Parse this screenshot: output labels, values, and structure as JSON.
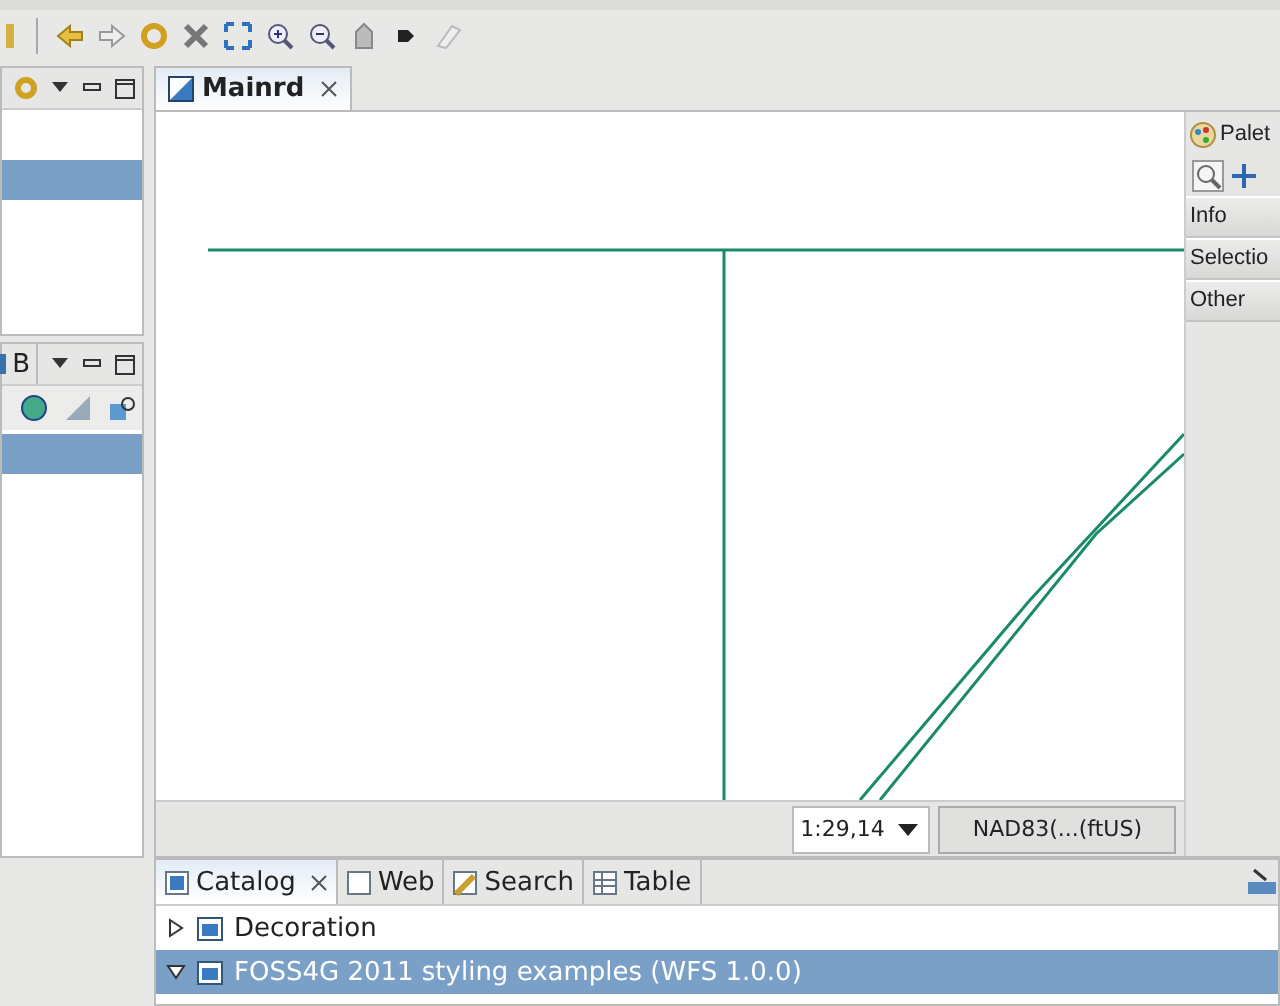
{
  "left_views": [
    {
      "selected_row": true
    },
    {
      "tab": "B",
      "selected_row": true
    }
  ],
  "editor": {
    "tab": {
      "label": "Mainrd",
      "selected": true
    },
    "status_bar": {
      "scale": "1:29,14",
      "crs": "NAD83(...(ftUS)"
    }
  },
  "palette": {
    "title": "Palet",
    "sections": [
      "Info",
      "Selectio",
      "Other"
    ]
  },
  "bottom_panel": {
    "tabs": [
      {
        "label": "Catalog",
        "selected": true
      },
      {
        "label": "Web",
        "selected": false
      },
      {
        "label": "Search",
        "selected": false
      },
      {
        "label": "Table",
        "selected": false
      }
    ],
    "tree": [
      {
        "label": "Decoration",
        "expanded": false,
        "selected": false
      },
      {
        "label": "FOSS4G 2011 styling examples (WFS 1.0.0)",
        "expanded": true,
        "selected": true
      }
    ]
  }
}
